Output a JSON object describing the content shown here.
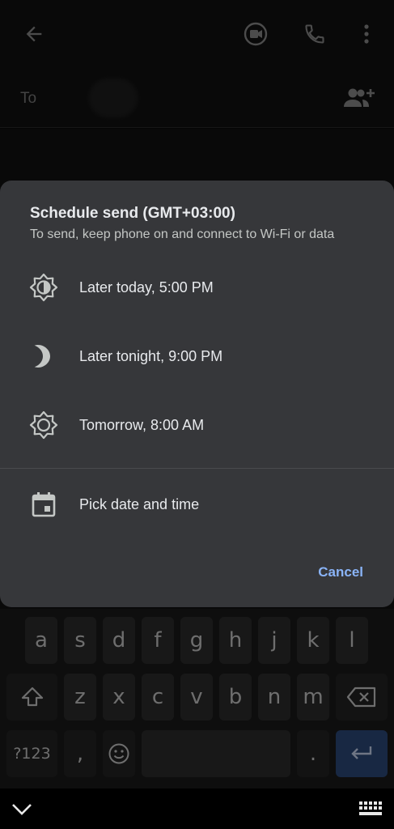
{
  "compose": {
    "to_label": "To"
  },
  "dialog": {
    "title": "Schedule send (GMT+03:00)",
    "subtitle": "To send, keep phone on and connect to Wi-Fi or data",
    "options": [
      {
        "label": "Later today, 5:00 PM",
        "icon": "sun-partial-icon"
      },
      {
        "label": "Later tonight, 9:00 PM",
        "icon": "moon-icon"
      },
      {
        "label": "Tomorrow, 8:00 AM",
        "icon": "sun-icon"
      },
      {
        "label": "Pick date and time",
        "icon": "calendar-icon"
      }
    ],
    "cancel_label": "Cancel",
    "accent_color": "#8ab4f8"
  },
  "keyboard": {
    "row1": [
      "a",
      "s",
      "d",
      "f",
      "g",
      "h",
      "j",
      "k",
      "l"
    ],
    "row2": [
      "z",
      "x",
      "c",
      "v",
      "b",
      "n",
      "m"
    ],
    "symbols_label": "?123",
    "comma": ",",
    "period": "."
  }
}
